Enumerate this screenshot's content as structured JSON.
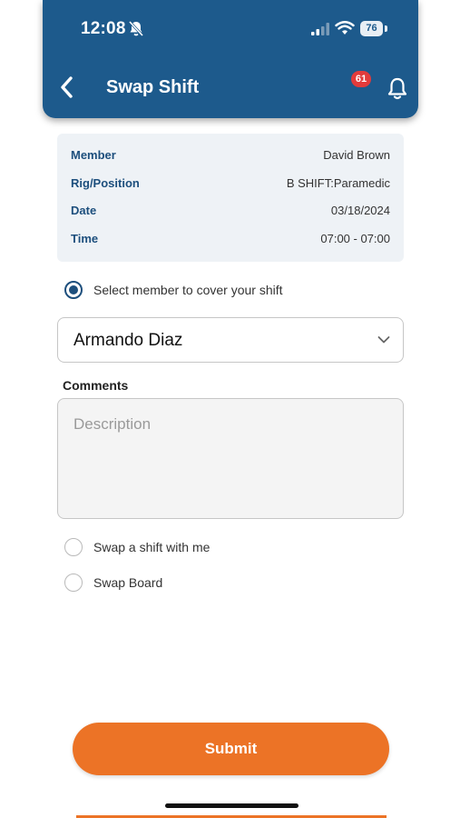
{
  "status_bar": {
    "time": "12:08",
    "battery": "76"
  },
  "header": {
    "title": "Swap Shift",
    "notification_count": "61"
  },
  "details": [
    {
      "label": "Member",
      "value": "David Brown"
    },
    {
      "label": "Rig/Position",
      "value": "B SHIFT:Paramedic"
    },
    {
      "label": "Date",
      "value": "03/18/2024"
    },
    {
      "label": "Time",
      "value": "07:00 - 07:00"
    }
  ],
  "options": {
    "cover": {
      "label": "Select member to cover your shift",
      "checked": true
    },
    "swap_with_me": {
      "label": "Swap a shift with me",
      "checked": false
    },
    "swap_board": {
      "label": "Swap Board",
      "checked": false
    }
  },
  "member_select": {
    "value": "Armando Diaz"
  },
  "comments": {
    "label": "Comments",
    "placeholder": "Description",
    "value": ""
  },
  "submit": {
    "label": "Submit"
  },
  "colors": {
    "header": "#1d5a8c",
    "accent": "#ec7326",
    "badge": "#e23b3b",
    "label": "#1d4f7d"
  },
  "icons": {
    "back": "chevron-left-icon",
    "notifications": "bell-icon",
    "mute": "bell-slash-icon",
    "dropdown": "chevron-down-icon"
  }
}
